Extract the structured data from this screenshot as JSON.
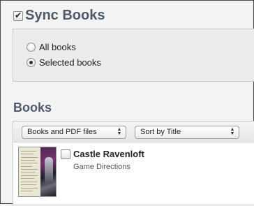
{
  "sync": {
    "label": "Sync Books",
    "checked": true,
    "options": [
      {
        "label": "All books",
        "selected": false
      },
      {
        "label": "Selected books",
        "selected": true
      }
    ]
  },
  "books": {
    "title": "Books",
    "filter_popup": "Books and PDF files",
    "sort_popup": "Sort by Title",
    "items": [
      {
        "title": "Castle Ravenloft",
        "author": "Game Directions",
        "checked": false
      }
    ]
  },
  "colors": {
    "heading": "#4e5a6a",
    "panel": "#ececec"
  }
}
